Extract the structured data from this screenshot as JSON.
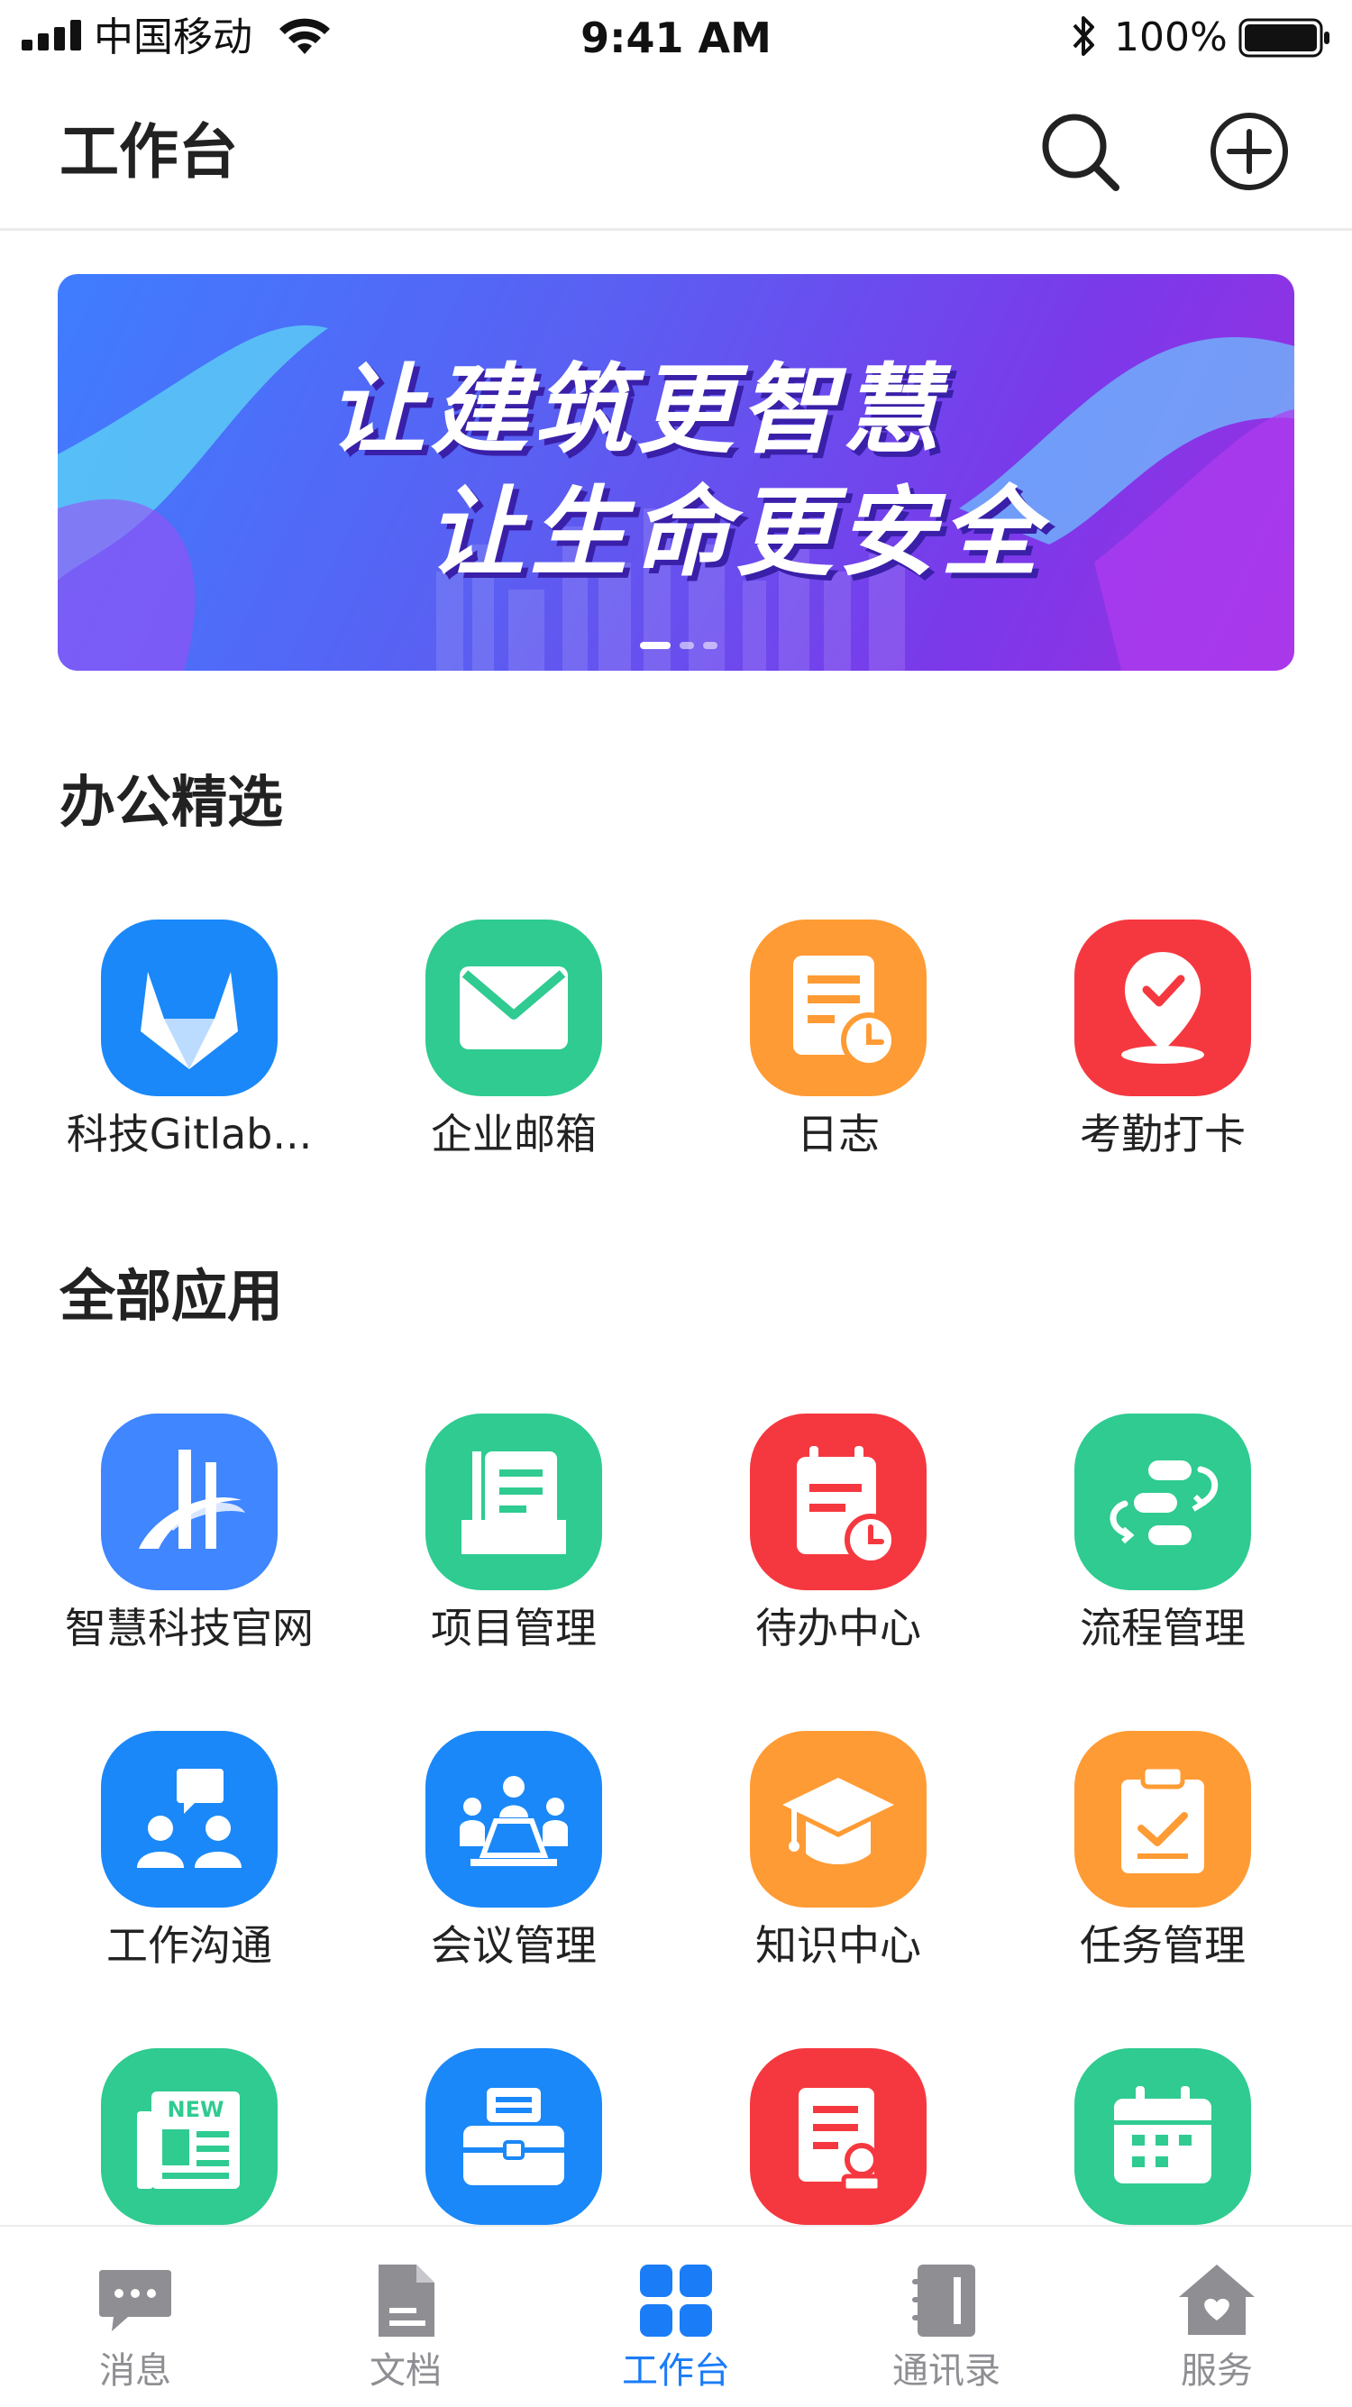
{
  "status_bar": {
    "carrier": "中国移动",
    "time": "9:41 AM",
    "battery": "100%"
  },
  "header": {
    "title": "工作台"
  },
  "banner": {
    "line1": "让建筑更智慧",
    "line2": "让生命更安全"
  },
  "featured": {
    "title": "办公精选",
    "apps": [
      {
        "label": "科技Gitlab...",
        "icon": "gitlab-icon",
        "color": "#1a88f8"
      },
      {
        "label": "企业邮箱",
        "icon": "mail-icon",
        "color": "#2fcb91"
      },
      {
        "label": "日志",
        "icon": "log-icon",
        "color": "#ff9b34"
      },
      {
        "label": "考勤打卡",
        "icon": "location-check-icon",
        "color": "#f5383f"
      }
    ]
  },
  "all_apps": {
    "title": "全部应用",
    "apps": [
      {
        "label": "智慧科技官网",
        "icon": "website-logo-icon",
        "color": "#3f86ff"
      },
      {
        "label": "项目管理",
        "icon": "project-icon",
        "color": "#2fcb91"
      },
      {
        "label": "待办中心",
        "icon": "todo-icon",
        "color": "#f5383f"
      },
      {
        "label": "流程管理",
        "icon": "process-icon",
        "color": "#2fcb91"
      },
      {
        "label": "工作沟通",
        "icon": "communication-icon",
        "color": "#1a88f8"
      },
      {
        "label": "会议管理",
        "icon": "meeting-icon",
        "color": "#1a88f8"
      },
      {
        "label": "知识中心",
        "icon": "graduation-cap-icon",
        "color": "#ff9b34"
      },
      {
        "label": "任务管理",
        "icon": "clipboard-check-icon",
        "color": "#ff9b34"
      },
      {
        "label": "",
        "icon": "news-icon",
        "color": "#2fcb91"
      },
      {
        "label": "",
        "icon": "briefcase-icon",
        "color": "#1a88f8"
      },
      {
        "label": "",
        "icon": "document-stamp-icon",
        "color": "#f5383f"
      },
      {
        "label": "",
        "icon": "calendar-icon",
        "color": "#2fcb91"
      }
    ]
  },
  "tabbar": {
    "items": [
      {
        "label": "消息",
        "icon": "chat-icon"
      },
      {
        "label": "文档",
        "icon": "document-icon"
      },
      {
        "label": "工作台",
        "icon": "grid-icon",
        "active": true
      },
      {
        "label": "通讯录",
        "icon": "contacts-icon"
      },
      {
        "label": "服务",
        "icon": "house-heart-icon"
      }
    ],
    "active_color": "#1a7cf7",
    "inactive_color": "#8e8e93"
  },
  "badge_text": {
    "news": "NEW"
  }
}
